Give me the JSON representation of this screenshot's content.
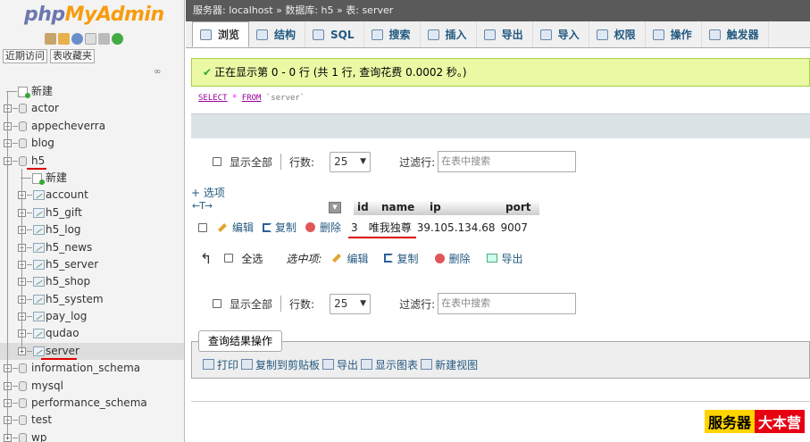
{
  "nav": {
    "logo_php": "php",
    "logo_myadmin": "MyAdmin",
    "recent_tab": "近期访问",
    "favorites_tab": "表收藏夹",
    "collapse_link": "∞",
    "tree": [
      {
        "label": "新建",
        "type": "new",
        "level": 0
      },
      {
        "label": "actor",
        "type": "db",
        "level": 0
      },
      {
        "label": "appecheverra",
        "type": "db",
        "level": 0
      },
      {
        "label": "blog",
        "type": "db",
        "level": 0
      },
      {
        "label": "h5",
        "type": "db",
        "level": 0,
        "expanded": true
      },
      {
        "label": "新建",
        "type": "new",
        "level": 1
      },
      {
        "label": "account",
        "type": "table",
        "level": 1
      },
      {
        "label": "h5_gift",
        "type": "table",
        "level": 1
      },
      {
        "label": "h5_log",
        "type": "table",
        "level": 1
      },
      {
        "label": "h5_news",
        "type": "table",
        "level": 1
      },
      {
        "label": "h5_server",
        "type": "table",
        "level": 1
      },
      {
        "label": "h5_shop",
        "type": "table",
        "level": 1
      },
      {
        "label": "h5_system",
        "type": "table",
        "level": 1
      },
      {
        "label": "pay_log",
        "type": "table",
        "level": 1
      },
      {
        "label": "qudao",
        "type": "table",
        "level": 1
      },
      {
        "label": "server",
        "type": "table",
        "level": 1,
        "active": true
      },
      {
        "label": "information_schema",
        "type": "db",
        "level": 0
      },
      {
        "label": "mysql",
        "type": "db",
        "level": 0
      },
      {
        "label": "performance_schema",
        "type": "db",
        "level": 0
      },
      {
        "label": "test",
        "type": "db",
        "level": 0
      },
      {
        "label": "wp",
        "type": "db",
        "level": 0
      }
    ]
  },
  "breadcrumb": {
    "server_label": "服务器: localhost",
    "db_label": "数据库: h5",
    "table_label": "表: server",
    "sep": "»"
  },
  "tabs": [
    {
      "label": "浏览",
      "icon": "browse-icon",
      "active": true
    },
    {
      "label": "结构",
      "icon": "structure-icon"
    },
    {
      "label": "SQL",
      "icon": "sql-icon"
    },
    {
      "label": "搜索",
      "icon": "search-icon"
    },
    {
      "label": "插入",
      "icon": "insert-icon"
    },
    {
      "label": "导出",
      "icon": "export-icon"
    },
    {
      "label": "导入",
      "icon": "import-icon"
    },
    {
      "label": "权限",
      "icon": "privileges-icon"
    },
    {
      "label": "操作",
      "icon": "operations-icon"
    },
    {
      "label": "触发器",
      "icon": "triggers-icon"
    }
  ],
  "notice": "正在显示第 0 - 0 行 (共 1 行, 查询花费 0.0002 秒。)",
  "sql": {
    "select": "SELECT",
    "star": "*",
    "from": "FROM",
    "table": "`server`"
  },
  "navigation": {
    "show_all": "显示全部",
    "rows_label": "行数:",
    "rows_value": "25",
    "filter_label": "过滤行:",
    "filter_placeholder": "在表中搜索"
  },
  "options_link": "+ 选项",
  "arrows_label": "←T→",
  "columns": [
    "id",
    "name",
    "ip",
    "port"
  ],
  "rows": [
    {
      "id": "3",
      "name": "唯我独尊",
      "ip": "39.105.134.68",
      "port": "9007"
    }
  ],
  "row_actions": {
    "edit": "编辑",
    "copy": "复制",
    "delete": "删除"
  },
  "with_selected": {
    "check_all": "全选",
    "label": "选中项:",
    "edit": "编辑",
    "copy": "复制",
    "delete": "删除",
    "export": "导出"
  },
  "query_ops": {
    "legend": "查询结果操作",
    "print": "打印",
    "copy_clipboard": "复制到剪贴板",
    "export": "导出",
    "chart": "显示图表",
    "create_view": "新建视图"
  },
  "watermark": {
    "part1": "服务器",
    "part2": "大本营"
  },
  "colors": {
    "link": "#235a81",
    "notice_bg": "#ebf8a4",
    "breadcrumb_bg": "#5a5a5a",
    "highlight_underline": "#dd0000"
  }
}
